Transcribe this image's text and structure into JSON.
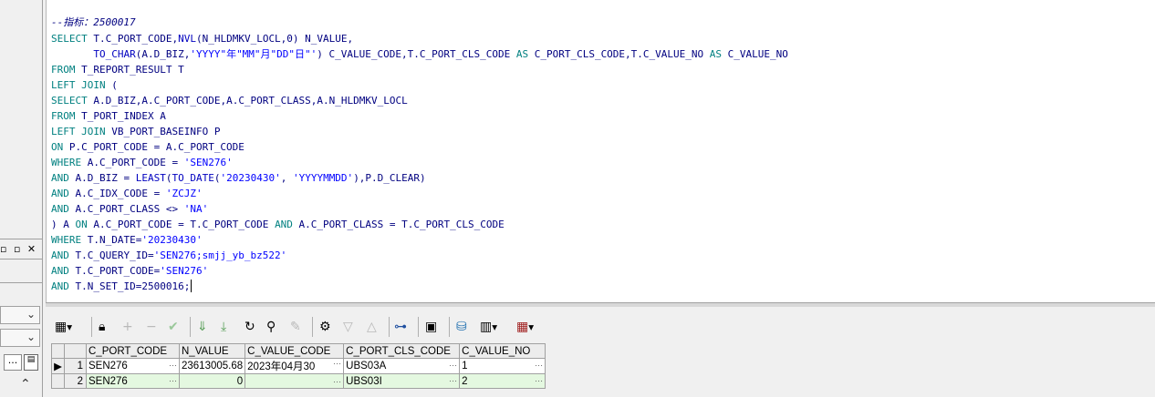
{
  "editor": {
    "comment": "--指标：2500017",
    "lines": [
      {
        "a": "SELECT",
        "b": " T.C_PORT_CODE,",
        "c": "NVL",
        "d": "(N_HLDMKV_LOCL,0) N_VALUE,"
      },
      {
        "a": "       TO_CHAR",
        "b": "(A.D_BIZ,",
        "c": "'YYYY\"年\"MM\"月\"DD\"日\"'",
        "d": ") C_VALUE_CODE,T.C_PORT_CLS_CODE ",
        "e": "AS",
        "f": " C_PORT_CLS_CODE,T.C_VALUE_NO ",
        "g": "AS",
        "h": " C_VALUE_NO"
      },
      {
        "a": "FROM",
        "b": " T_REPORT_RESULT T"
      },
      {
        "a": "LEFT JOIN",
        "b": " ("
      },
      {
        "a": "SELECT",
        "b": " A.D_BIZ,A.C_PORT_CODE,A.C_PORT_CLASS,A.N_HLDMKV_LOCL"
      },
      {
        "a": "FROM",
        "b": " T_PORT_INDEX A"
      },
      {
        "a": "LEFT JOIN",
        "b": " VB_PORT_BASEINFO P"
      },
      {
        "a": "ON",
        "b": " P.C_PORT_CODE = A.C_PORT_CODE"
      },
      {
        "a": "WHERE",
        "b": " A.C_PORT_CODE = ",
        "c": "'SEN276'"
      },
      {
        "a": "AND",
        "b": " A.D_BIZ = ",
        "c": "LEAST",
        "d": "(",
        "e": "TO_DATE",
        "f": "(",
        "g": "'20230430'",
        "h": ", ",
        "i": "'YYYYMMDD'",
        "j": "),P.D_CLEAR)"
      },
      {
        "a": "AND",
        "b": " A.C_IDX_CODE = ",
        "c": "'ZCJZ'"
      },
      {
        "a": "AND",
        "b": " A.C_PORT_CLASS <> ",
        "c": "'NA'"
      },
      {
        "a": ") A ",
        "b": "ON",
        "c": " A.C_PORT_CODE = T.C_PORT_CODE ",
        "d": "AND",
        "e": " A.C_PORT_CLASS = T.C_PORT_CLS_CODE"
      },
      {
        "a": "WHERE",
        "b": " T.N_DATE=",
        "c": "'20230430'"
      },
      {
        "a": "AND",
        "b": " T.C_QUERY_ID=",
        "c": "'SEN276;smjj_yb_bz522'"
      },
      {
        "a": "AND",
        "b": " T.C_PORT_CODE=",
        "c": "'SEN276'"
      },
      {
        "a": "AND",
        "b": " T.N_SET_ID=2500016;"
      }
    ]
  },
  "grid": {
    "columns": [
      "C_PORT_CODE",
      "N_VALUE",
      "C_VALUE_CODE",
      "C_PORT_CLS_CODE",
      "C_VALUE_NO"
    ],
    "rows": [
      {
        "num": "1",
        "C_PORT_CODE": "SEN276",
        "N_VALUE": "23613005.68",
        "C_VALUE_CODE": "2023年04月30",
        "C_PORT_CLS_CODE": "UBS03A",
        "C_VALUE_NO": "1"
      },
      {
        "num": "2",
        "C_PORT_CODE": "SEN276",
        "N_VALUE": "0",
        "C_VALUE_CODE": "",
        "C_PORT_CLS_CODE": "UBS03I",
        "C_VALUE_NO": "2"
      }
    ],
    "current_row_marker": "▶",
    "ellipsis": "···"
  },
  "left_panel": {
    "window_buttons": "▫ ▫ ✕",
    "dots_button": "...",
    "dropdown_arrow": "⌄",
    "scroll_up": "⌃"
  },
  "colors": {
    "keyword": "#008080",
    "function": "#0000c0",
    "string": "#0000ff",
    "comment": "#d00000",
    "identifier": "#000080",
    "row2_bg": "#e4f8e0"
  }
}
